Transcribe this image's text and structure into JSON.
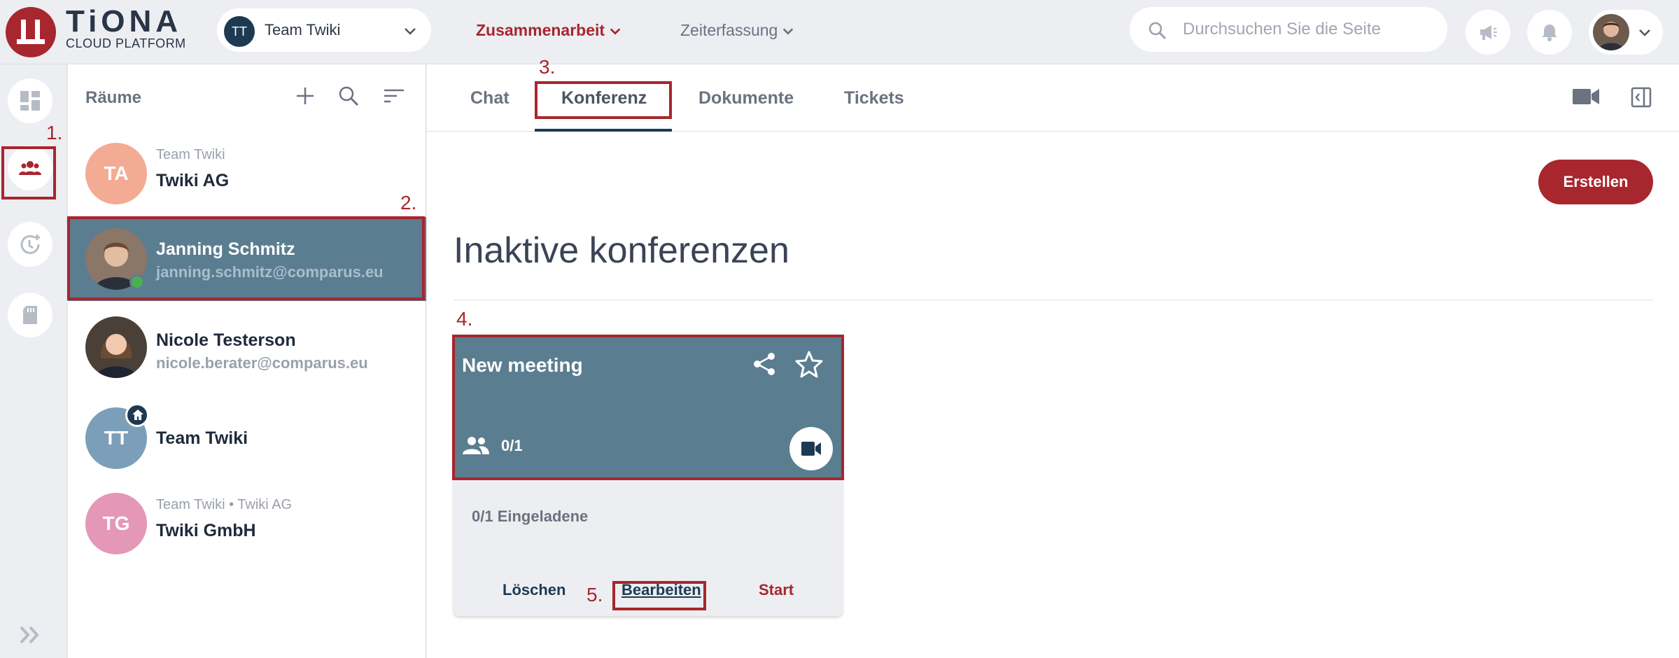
{
  "brand": {
    "title": "TiONA",
    "subtitle": "CLOUD PLATFORM",
    "color": "#a8262d"
  },
  "team_select": {
    "initials": "TT",
    "label": "Team Twiki"
  },
  "nav": {
    "collaboration": "Zusammenarbeit",
    "time_tracking": "Zeiterfassung"
  },
  "search": {
    "placeholder": "Durchsuchen Sie die Seite"
  },
  "rooms": {
    "title": "Räume",
    "items": [
      {
        "initials": "TA",
        "supertitle": "Team Twiki",
        "name": "Twiki AG",
        "color": "#f4ab94"
      },
      {
        "name": "Janning Schmitz",
        "email": "janning.schmitz@comparus.eu",
        "active": true
      },
      {
        "name": "Nicole Testerson",
        "email": "nicole.berater@comparus.eu"
      },
      {
        "initials": "TT",
        "name": "Team Twiki",
        "color": "#7b9fb8"
      },
      {
        "initials": "TG",
        "supertitle": "Team Twiki • Twiki AG",
        "name": "Twiki GmbH",
        "color": "#e597b8"
      }
    ]
  },
  "tabs": [
    "Chat",
    "Konferenz",
    "Dokumente",
    "Tickets"
  ],
  "main": {
    "create_label": "Erstellen",
    "section_title": "Inaktive konferenzen",
    "card": {
      "title": "New meeting",
      "participants": "0/1",
      "invited": "0/1 Eingeladene",
      "delete_label": "Löschen",
      "edit_label": "Bearbeiten",
      "start_label": "Start"
    }
  },
  "annotations": [
    "1.",
    "2.",
    "3.",
    "4.",
    "5."
  ]
}
